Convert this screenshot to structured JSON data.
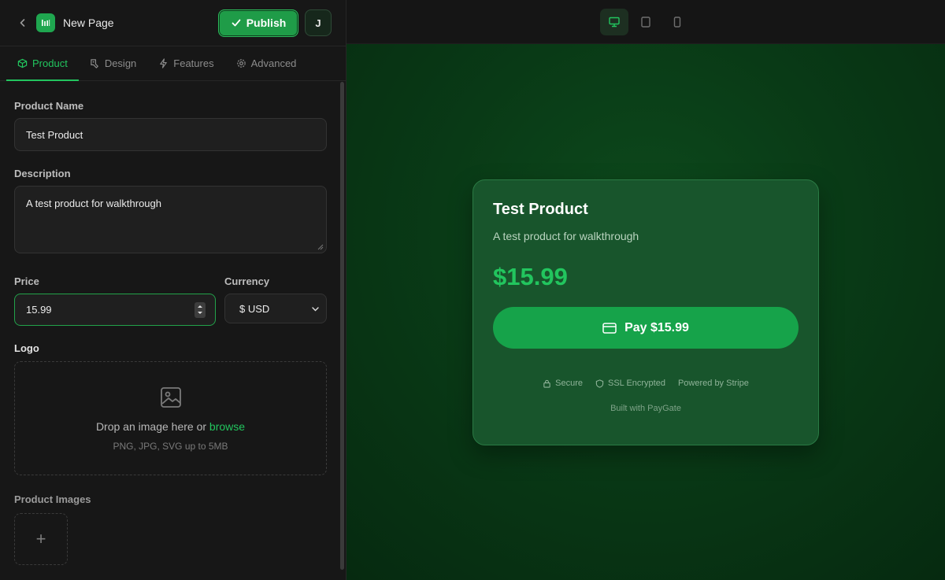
{
  "header": {
    "title": "New Page",
    "publish_label": "Publish",
    "avatar_initial": "J"
  },
  "tabs": [
    {
      "label": "Product",
      "active": true,
      "icon": "box-icon"
    },
    {
      "label": "Design",
      "active": false,
      "icon": "palette-icon"
    },
    {
      "label": "Features",
      "active": false,
      "icon": "bolt-icon"
    },
    {
      "label": "Advanced",
      "active": false,
      "icon": "gear-icon"
    }
  ],
  "form": {
    "product_name": {
      "label": "Product Name",
      "value": "Test Product"
    },
    "description": {
      "label": "Description",
      "value": "A test product for walkthrough"
    },
    "price": {
      "label": "Price",
      "value": "15.99"
    },
    "currency": {
      "label": "Currency",
      "value": "$ USD"
    },
    "logo": {
      "label": "Logo",
      "drop_text": "Drop an image here or",
      "browse_link": "browse",
      "hint": "PNG, JPG, SVG up to 5MB"
    },
    "product_images": {
      "label": "Product Images",
      "add_symbol": "+"
    }
  },
  "preview": {
    "devices": [
      "desktop-icon",
      "tablet-icon",
      "mobile-icon"
    ],
    "active_device": "desktop",
    "card": {
      "title": "Test Product",
      "description": "A test product for walkthrough",
      "price": "$15.99",
      "pay_label": "Pay $15.99",
      "badges": [
        "Secure",
        "SSL Encrypted",
        "Powered by Stripe"
      ],
      "built_with": "Built with PayGate"
    }
  },
  "colors": {
    "accent": "#22c55e",
    "publish": "#1f9c48",
    "preview_bg": "#093a16",
    "card_bg": "#18552c"
  }
}
